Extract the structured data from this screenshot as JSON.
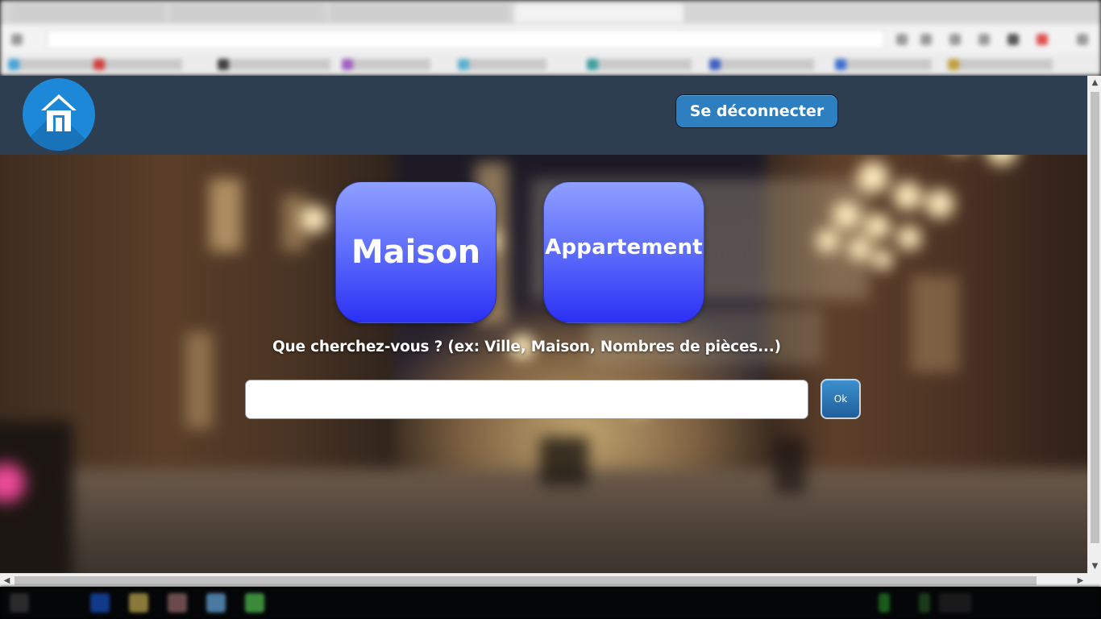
{
  "header": {
    "logout_label": "Se déconnecter"
  },
  "categories": [
    {
      "label": "Maison"
    },
    {
      "label": "Appartement"
    }
  ],
  "search": {
    "prompt": "Que cherchez-vous ? (ex: Ville, Maison, Nombres de pièces...)",
    "value": "",
    "submit_label": "Ok"
  },
  "icons": {
    "logo": "home-icon",
    "scroll_up": "chevron-up-icon",
    "scroll_down": "chevron-down-icon",
    "scroll_left": "chevron-left-icon",
    "scroll_right": "chevron-right-icon"
  },
  "colors": {
    "header_bg": "#2c3e50",
    "logo_bg": "#1e88d8",
    "logout_bg": "#2e7fbf",
    "tile_top": "#8fa0ff",
    "tile_bottom": "#2b30f3",
    "ok_bg": "#2a73b3"
  }
}
